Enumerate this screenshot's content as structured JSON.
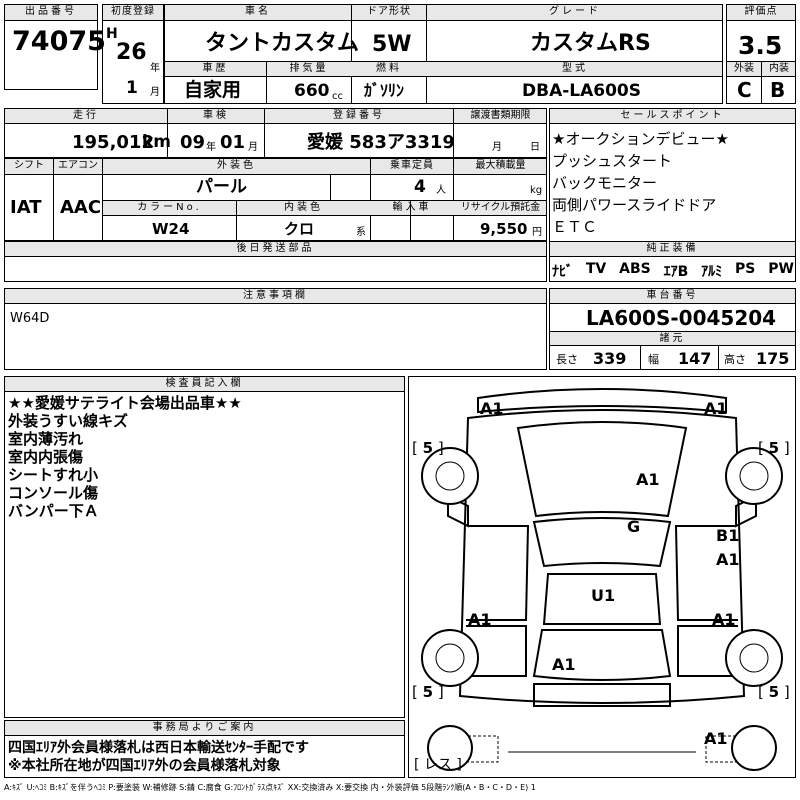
{
  "lot": {
    "label": "出品番号",
    "value": "74075"
  },
  "first_reg": {
    "label": "初度登録",
    "era": "H",
    "year": "26",
    "year_unit": "年",
    "month": "1",
    "month_unit": "月"
  },
  "car_name": {
    "label": "車名",
    "value": "タントカスタム"
  },
  "door": {
    "label": "ドア形状",
    "value": "5W"
  },
  "grade": {
    "label": "グレード",
    "value": "カスタムRS"
  },
  "score": {
    "label": "評価点",
    "value": "3.5"
  },
  "history": {
    "label": "車歴",
    "value": "自家用"
  },
  "displacement": {
    "label": "排気量",
    "value": "660",
    "unit": "cc"
  },
  "fuel": {
    "label": "燃料",
    "value": "ｶﾞｿﾘﾝ"
  },
  "model": {
    "label": "型式",
    "value": "DBA-LA600S"
  },
  "exterior_grade": {
    "label": "外装",
    "value": "C"
  },
  "interior_grade": {
    "label": "内装",
    "value": "B"
  },
  "mileage": {
    "label": "走行",
    "value": "195,012",
    "unit": "km"
  },
  "inspection": {
    "label": "車検",
    "year": "09",
    "year_unit": "年",
    "month": "01",
    "month_unit": "月"
  },
  "registration": {
    "label": "登録番号",
    "value": "愛媛 583ア3319"
  },
  "transfer_deadline": {
    "label": "譲渡書類期限",
    "month_unit": "月",
    "day_unit": "日"
  },
  "sales_points": {
    "label": "セールスポイント",
    "items": [
      "★オークションデビュー★",
      "プッシュスタート",
      "バックモニター",
      "両側パワースライドドア",
      "ＥＴＣ"
    ]
  },
  "shift": {
    "label": "シフト",
    "value": "IAT"
  },
  "aircon": {
    "label": "エアコン",
    "value": "AAC"
  },
  "ext_color": {
    "label": "外装色",
    "value": "パール"
  },
  "capacity": {
    "label": "乗車定員",
    "value": "4",
    "unit": "人"
  },
  "max_load": {
    "label": "最大積載量",
    "unit": "kg"
  },
  "color_no": {
    "label": "カラーNo.",
    "value": "W24"
  },
  "int_color": {
    "label": "内装色",
    "value": "クロ",
    "unit": "系"
  },
  "import": {
    "label": "輸入車"
  },
  "recycle": {
    "label": "リサイクル預託金",
    "value": "9,550",
    "unit": "円"
  },
  "later_parts": {
    "label": "後日発送部品"
  },
  "genuine_equipment": {
    "label": "純正装備",
    "items": [
      "ﾅﾋﾞ",
      "TV",
      "ABS",
      "ｴｱB",
      "ｱﾙﾐ",
      "PS",
      "PW"
    ]
  },
  "caution": {
    "label": "注意事項欄",
    "value": "W64D"
  },
  "chassis": {
    "label": "車台番号",
    "value": "LA600S-0045204"
  },
  "specs": {
    "label": "諸元",
    "length_label": "長さ",
    "length": "339",
    "width_label": "幅",
    "width": "147",
    "height_label": "高さ",
    "height": "175"
  },
  "inspector": {
    "label": "検査員記入欄",
    "notes": [
      "★★愛媛サテライト会場出品車★★",
      "外装うすい線キズ",
      "室内薄汚れ",
      "室内内張傷",
      "シートすれ小",
      "コンソール傷",
      "バンパー下Ａ"
    ]
  },
  "office": {
    "label": "事務局よりご案内",
    "lines": [
      "四国ｴﾘｱ外会員様落札は西日本輸送ｾﾝﾀｰ手配です",
      "※本社所在地が四国ｴﾘｱ外の会員様落札対象"
    ]
  },
  "diagram_marks": {
    "front_left": "A1",
    "front_right": "A1",
    "hood": "A1",
    "windshield": "G",
    "right_front_door_1": "B1",
    "right_front_door_2": "A1",
    "roof": "U1",
    "left_rear": "A1",
    "right_rear": "A1",
    "rear_window": "A1",
    "rear_right": "A1"
  },
  "tires": {
    "fl": "5",
    "fr": "5",
    "rl": "5",
    "rr": "5",
    "spare": "レス"
  },
  "legend": "A:ｷｽﾞ U:ﾍｺﾐ B:ｷｽﾞを伴うﾍｺﾐ P:要塗装 W:補修跡 S:錆 C:腐食 G:ﾌﾛﾝﾄｶﾞﾗｽ点ｷｽﾞ XX:交換済み X:要交換 内・外装評価 5段階ﾗﾝｸ順(A・B・C・D・E) 1"
}
